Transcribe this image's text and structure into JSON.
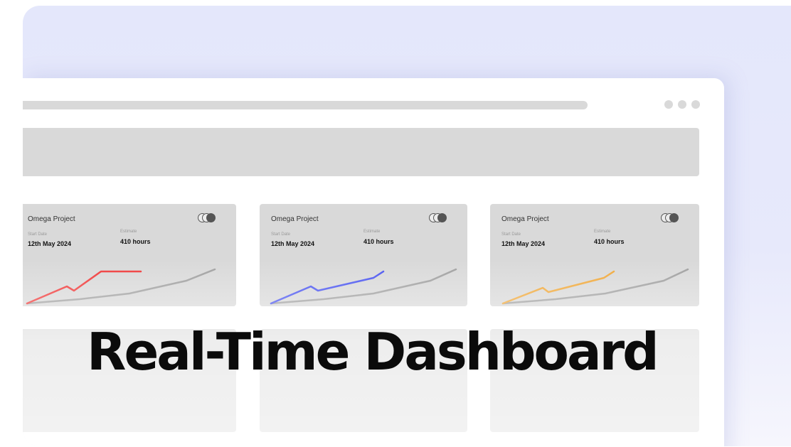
{
  "headline": "Real-Time Dashboard",
  "cards": [
    {
      "title": "Omega Project",
      "start_label": "Start Date",
      "start_value": "12th May 2024",
      "estimate_label": "Estimate",
      "estimate_value": "410 hours",
      "accent_color": "#f03a3a"
    },
    {
      "title": "Omega Project",
      "start_label": "Start Date",
      "start_value": "12th May 2024",
      "estimate_label": "Estimate",
      "estimate_value": "410 hours",
      "accent_color": "#4a55f0"
    },
    {
      "title": "Omega Project",
      "start_label": "Start Date",
      "start_value": "12th May 2024",
      "estimate_label": "Estimate",
      "estimate_value": "410 hours",
      "accent_color": "#f0a83a"
    }
  ],
  "colors": {
    "background": "#e4e7fb",
    "placeholder": "#d9d9d9",
    "baseline_line": "#a0a0a0"
  },
  "icons": [
    "window-dots-icon",
    "avatar-group-icon"
  ]
}
